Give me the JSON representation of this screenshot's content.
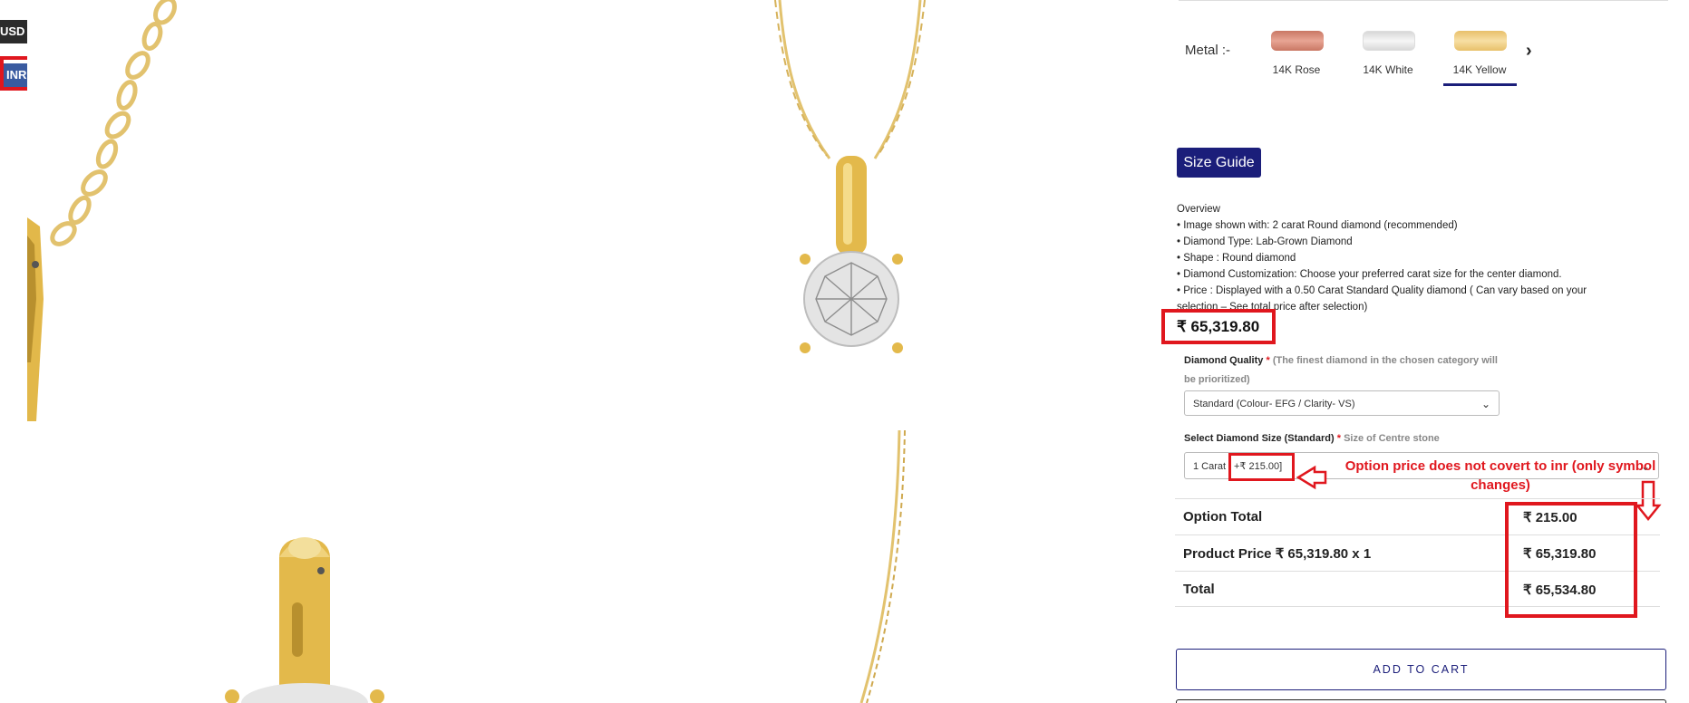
{
  "currency": {
    "usd_label": "USD $",
    "inr_label": "INR ₹"
  },
  "metal": {
    "label": "Metal :-",
    "options": [
      {
        "label": "14K Rose",
        "color": "#d98e7a"
      },
      {
        "label": "14K White",
        "color": "#e8e8e8"
      },
      {
        "label": "14K Yellow",
        "color": "#f0cf8a"
      }
    ],
    "selected": "14K Yellow"
  },
  "size_guide_label": "Size Guide",
  "overview": {
    "heading": "Overview",
    "lines": [
      "• Image shown with: 2 carat Round diamond (recommended)",
      "• Diamond Type: Lab-Grown Diamond",
      "• Shape : Round diamond",
      "• Diamond Customization: Choose your preferred carat size for the center diamond.",
      "• Price : Displayed with a 0.50 Carat Standard Quality diamond ( Can vary based on your",
      "selection – See total price after selection)"
    ]
  },
  "price": "₹ 65,319.80",
  "diamond_quality": {
    "label": "Diamond Quality",
    "required": "*",
    "hint_line1": "(The finest diamond in the chosen category will",
    "hint_line2": "be prioritized)",
    "selected": "Standard (Colour- EFG / Clarity- VS)"
  },
  "diamond_size": {
    "label": "Select Diamond Size (Standard)",
    "required": "*",
    "hint": "Size of Centre stone",
    "selected_prefix": "1 Carat",
    "option_price": "+₹ 215.00]"
  },
  "annotation": "Option price does not covert to inr (only symbol changes)",
  "totals": [
    {
      "label": "Option Total",
      "value": "₹ 215.00"
    },
    {
      "label": "Product Price ₹ 65,319.80 x 1",
      "value": "₹ 65,319.80"
    },
    {
      "label": "Total",
      "value": "₹ 65,534.80"
    }
  ],
  "add_to_cart_label": "ADD TO CART",
  "colors": {
    "accent": "#1b1e7a",
    "highlight_red": "#e0171e",
    "gold": "#e2c26e"
  }
}
